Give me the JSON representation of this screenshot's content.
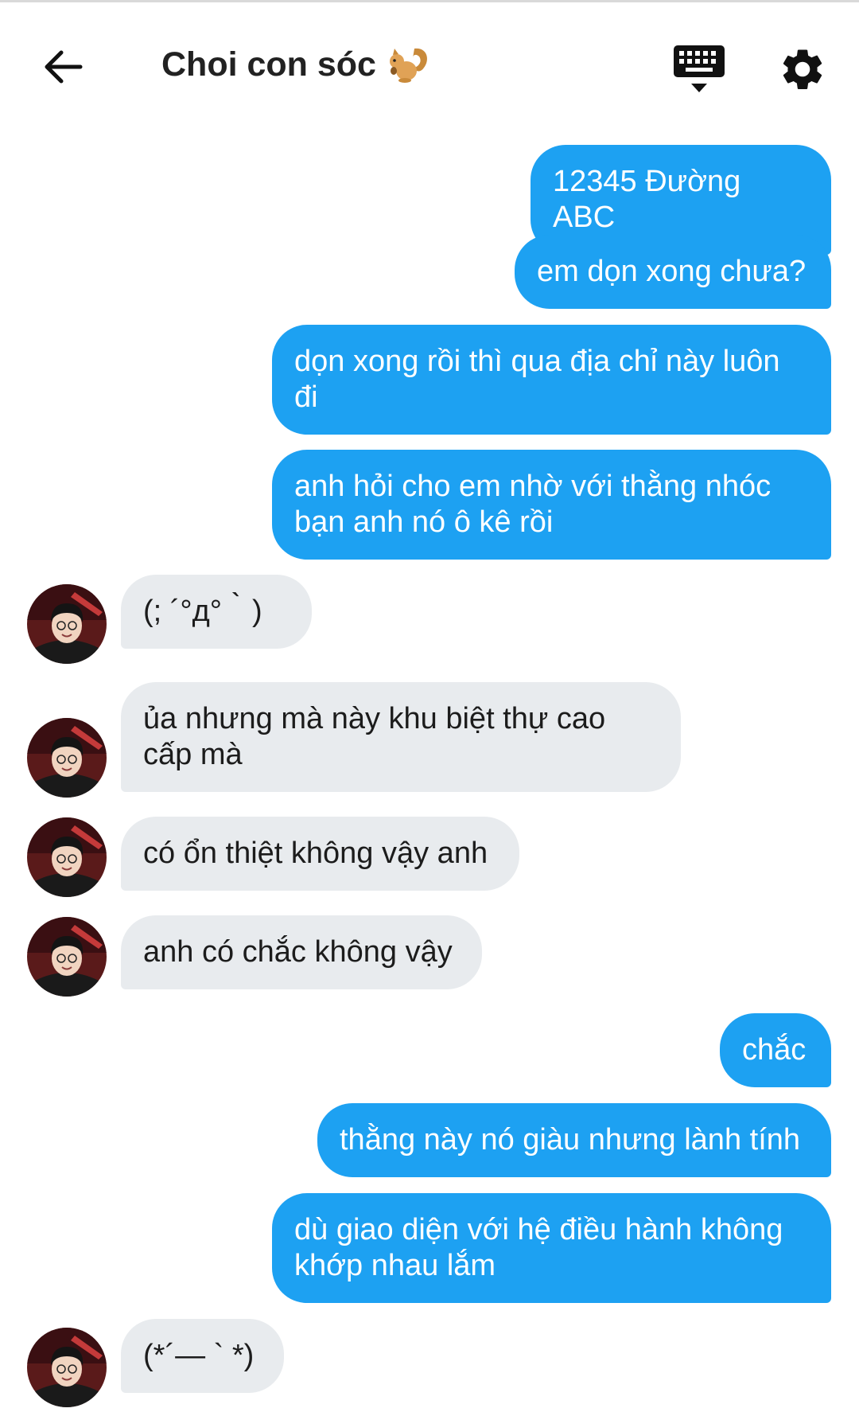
{
  "header": {
    "title": "Choi con sóc",
    "title_emoji": "squirrel-emoji",
    "back_icon": "arrow-left-icon",
    "keyboard_icon": "keyboard-icon",
    "settings_icon": "gear-icon"
  },
  "colors": {
    "outgoing_bubble": "#1da1f2",
    "incoming_bubble": "#e8ebee"
  },
  "messages": [
    {
      "side": "out",
      "text": "12345 Đường ABC"
    },
    {
      "side": "out",
      "text": "em dọn xong chưa?"
    },
    {
      "side": "out",
      "text": "dọn xong rồi thì qua địa chỉ này luôn đi"
    },
    {
      "side": "out",
      "text": "anh hỏi cho em nhờ với thằng nhóc bạn anh nó ô kê rồi"
    },
    {
      "side": "in",
      "text": "(; ´°д°｀)"
    },
    {
      "side": "in",
      "text": "ủa nhưng mà này khu biệt thự cao cấp mà"
    },
    {
      "side": "in",
      "text": "có ổn thiệt không vậy anh"
    },
    {
      "side": "in",
      "text": "anh có chắc không vậy"
    },
    {
      "side": "out",
      "text": "chắc"
    },
    {
      "side": "out",
      "text": "thằng này nó giàu nhưng lành tính"
    },
    {
      "side": "out",
      "text": "dù giao diện với hệ điều hành không khớp nhau lắm"
    },
    {
      "side": "in",
      "text": "(*´— ` *)"
    }
  ]
}
